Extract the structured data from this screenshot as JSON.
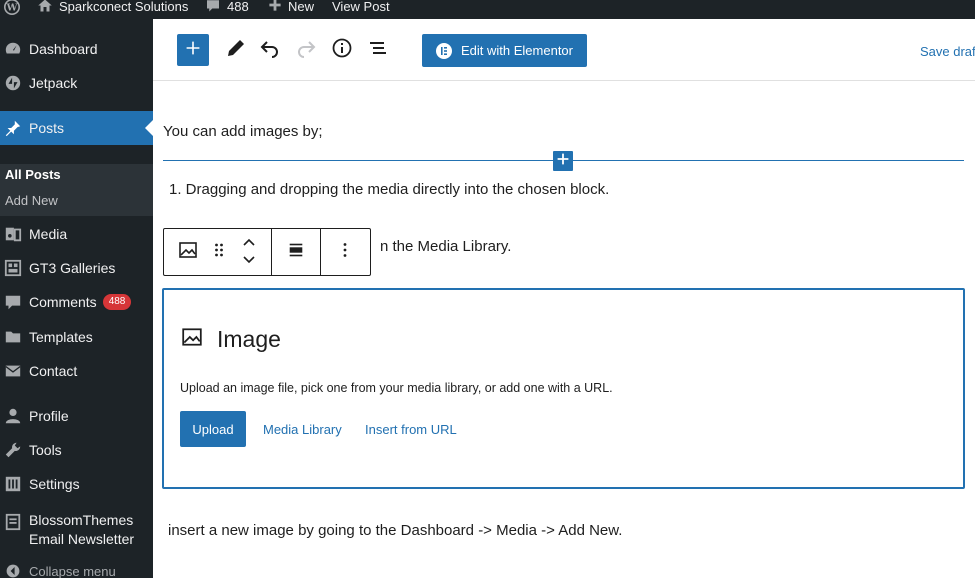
{
  "admin_bar": {
    "site_name": "Sparkconect Solutions",
    "comments_count": "488",
    "new_label": "New",
    "view_post_label": "View Post"
  },
  "sidebar": {
    "items": [
      {
        "label": "Dashboard",
        "icon": "dashboard-icon"
      },
      {
        "label": "Jetpack",
        "icon": "jetpack-icon"
      },
      {
        "label": "Posts",
        "icon": "pin-icon"
      },
      {
        "label": "Media",
        "icon": "media-icon"
      },
      {
        "label": "GT3 Galleries",
        "icon": "gallery-icon"
      },
      {
        "label": "Comments",
        "icon": "comment-icon",
        "badge": "488"
      },
      {
        "label": "Templates",
        "icon": "folder-icon"
      },
      {
        "label": "Contact",
        "icon": "mail-icon"
      },
      {
        "label": "Profile",
        "icon": "user-icon"
      },
      {
        "label": "Tools",
        "icon": "wrench-icon"
      },
      {
        "label": "Settings",
        "icon": "settings-icon"
      },
      {
        "label_line1": "BlossomThemes",
        "label_line2": "Email Newsletter",
        "icon": "newsletter-icon"
      }
    ],
    "submenu": {
      "all_posts": "All Posts",
      "add_new": "Add New"
    },
    "collapse_label": "Collapse menu"
  },
  "header": {
    "elementor_label": "Edit with Elementor",
    "save_draft_label": "Save draft"
  },
  "content": {
    "paragraph_add_images": "You can add images by;",
    "list_item_1": "1. Dragging and dropping the media directly into the chosen block.",
    "list_item_2_visible": "n the Media Library.",
    "image_block": {
      "title": "Image",
      "instructions": "Upload an image file, pick one from your media library, or add one with a URL.",
      "upload_label": "Upload",
      "media_library_label": "Media Library",
      "insert_url_label": "Insert from URL"
    },
    "paragraph_insert": "insert a new image by going to the Dashboard -> Media -> Add New."
  },
  "colors": {
    "admin_dark": "#1d2327",
    "accent_blue": "#2271b1",
    "badge_red": "#d63638"
  }
}
